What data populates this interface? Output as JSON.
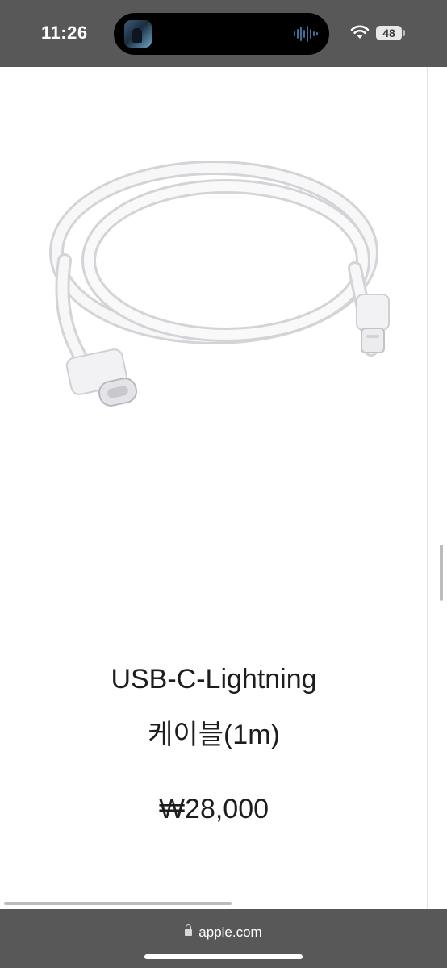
{
  "status_bar": {
    "time": "11:26",
    "battery": "48",
    "icons": [
      "media-thumbnail-icon",
      "audio-waveform-icon",
      "wifi-icon",
      "battery-icon"
    ]
  },
  "product": {
    "image_icon": "usb-c-lightning-cable-image",
    "title_line1": "USB-C-Lightning",
    "title_line2": "케이블(1m)",
    "price": "₩28,000"
  },
  "browser": {
    "url": "apple.com",
    "lock_icon": "lock-icon"
  },
  "colors": {
    "chrome": "#585858",
    "text": "#1d1d1f",
    "background": "#ffffff"
  }
}
